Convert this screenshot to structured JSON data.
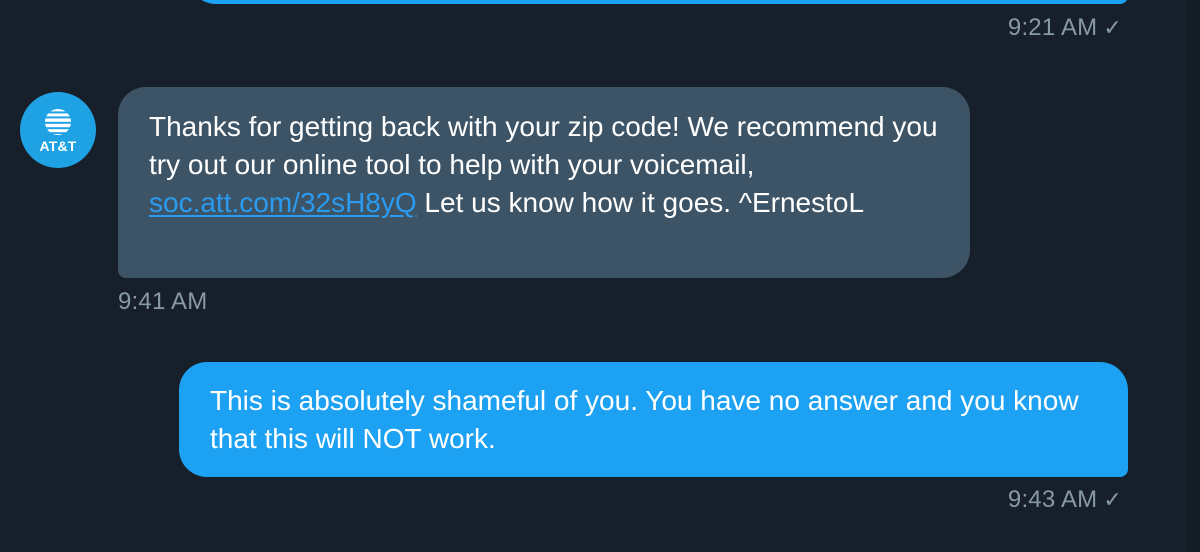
{
  "colors": {
    "background": "#17202a",
    "incoming_bubble": "#3d5466",
    "outgoing_bubble": "#1da1f2",
    "link": "#2a9bf0",
    "timestamp": "#8899a6",
    "avatar": "#1fa2e3"
  },
  "conversation": {
    "messages": [
      {
        "direction": "outgoing",
        "text": "",
        "timestamp": "9:21 AM",
        "status_icon": "check-icon"
      },
      {
        "direction": "incoming",
        "sender_avatar_label": "AT&T",
        "text_before_link": "Thanks for getting back with your zip code! We recommend you try out our online tool to help with your voicemail, ",
        "link_text": "soc.att.com/32sH8yQ",
        "text_after_link": " Let us know how it goes. ^ErnestoL",
        "timestamp": "9:41 AM"
      },
      {
        "direction": "outgoing",
        "text": "This is absolutely shameful of you. You have no answer and you know that this will NOT work.",
        "timestamp": "9:43 AM",
        "status_icon": "check-icon"
      }
    ]
  }
}
